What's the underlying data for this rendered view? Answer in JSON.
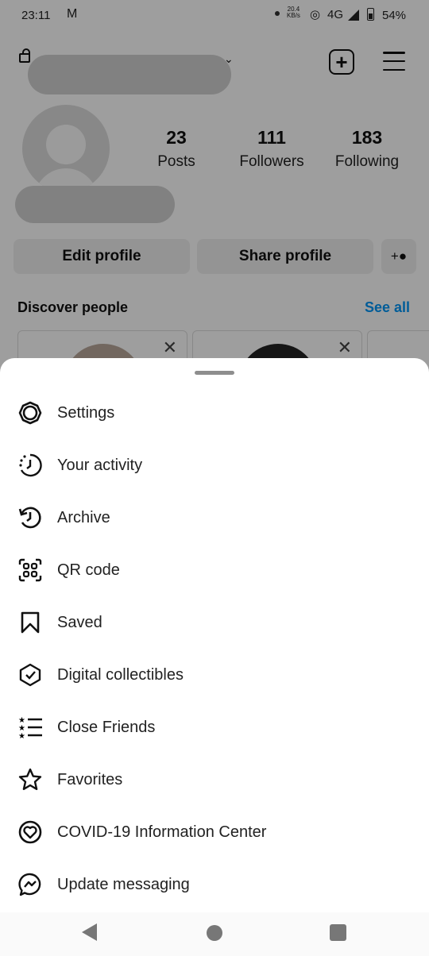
{
  "status_bar": {
    "time": "23:11",
    "mail_icon": "M",
    "speed_value": "20.4",
    "speed_unit": "KB/s",
    "network": "4G",
    "battery": "54%"
  },
  "profile": {
    "stats": [
      {
        "value": "23",
        "label": "Posts"
      },
      {
        "value": "111",
        "label": "Followers"
      },
      {
        "value": "183",
        "label": "Following"
      }
    ],
    "edit_label": "Edit profile",
    "share_label": "Share profile"
  },
  "discover": {
    "title": "Discover people",
    "see_all": "See all"
  },
  "menu": {
    "items": [
      {
        "label": "Settings",
        "icon": "gear-icon"
      },
      {
        "label": "Your activity",
        "icon": "activity-icon"
      },
      {
        "label": "Archive",
        "icon": "archive-icon"
      },
      {
        "label": "QR code",
        "icon": "qr-code-icon"
      },
      {
        "label": "Saved",
        "icon": "bookmark-icon"
      },
      {
        "label": "Digital collectibles",
        "icon": "collectibles-icon"
      },
      {
        "label": "Close Friends",
        "icon": "close-friends-icon"
      },
      {
        "label": "Favorites",
        "icon": "star-icon"
      },
      {
        "label": "COVID-19 Information Center",
        "icon": "covid-heart-icon"
      },
      {
        "label": "Update messaging",
        "icon": "messenger-icon"
      }
    ]
  },
  "colors": {
    "accent": "#0095f6",
    "button_bg": "#efefef",
    "overlay": "rgba(0,0,0,0.38)"
  }
}
